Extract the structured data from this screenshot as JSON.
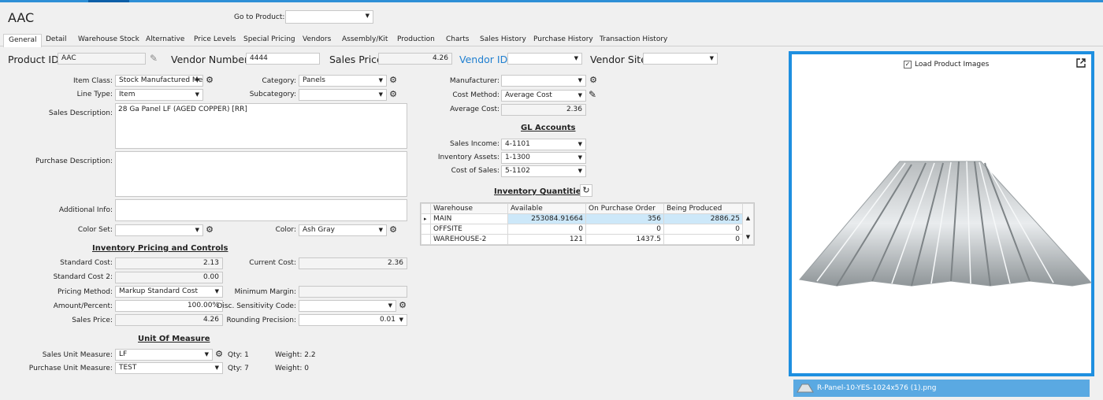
{
  "header": {
    "title": "AAC",
    "goto_label": "Go to Product:",
    "goto_value": ""
  },
  "tabs": [
    "General",
    "Detail",
    "Warehouse Stock",
    "Alternative",
    "Price Levels",
    "Special Pricing",
    "Vendors",
    "Assembly/Kit",
    "Production",
    "Charts",
    "Sales History",
    "Purchase History",
    "Transaction History"
  ],
  "top": {
    "product_id_label": "Product ID:",
    "product_id": "AAC",
    "vendor_number_label": "Vendor Number:",
    "vendor_number": "4444",
    "sales_price_label": "Sales Price:",
    "sales_price": "4.26",
    "vendor_id_label": "Vendor ID:",
    "vendor_id": "",
    "vendor_site_label": "Vendor Site:",
    "vendor_site": ""
  },
  "general": {
    "item_class_label": "Item Class:",
    "item_class": "Stock Manufactured Me",
    "line_type_label": "Line Type:",
    "line_type": "Item",
    "category_label": "Category:",
    "category": "Panels",
    "subcategory_label": "Subcategory:",
    "subcategory": "",
    "sales_description_label": "Sales Description:",
    "sales_description": "28 Ga Panel LF (AGED COPPER) [RR]",
    "purchase_description_label": "Purchase Description:",
    "purchase_description": "",
    "additional_info_label": "Additional Info:",
    "additional_info": "",
    "color_set_label": "Color Set:",
    "color_set": "",
    "color_label": "Color:",
    "color": "Ash Gray"
  },
  "pricing": {
    "title": "Inventory Pricing and Controls",
    "standard_cost_label": "Standard Cost:",
    "standard_cost": "2.13",
    "current_cost_label": "Current Cost:",
    "current_cost": "2.36",
    "standard_cost2_label": "Standard Cost 2:",
    "standard_cost2": "0.00",
    "pricing_method_label": "Pricing Method:",
    "pricing_method": "Markup Standard Cost",
    "minimum_margin_label": "Minimum Margin:",
    "minimum_margin": "",
    "amount_percent_label": "Amount/Percent:",
    "amount_percent": "100.00%",
    "disc_sensitivity_label": "Disc. Sensitivity Code:",
    "disc_sensitivity": "",
    "sales_price_label": "Sales Price:",
    "sales_price": "4.26",
    "rounding_label": "Rounding Precision:",
    "rounding": "0.01"
  },
  "uom": {
    "title": "Unit Of Measure",
    "sales_label": "Sales Unit Measure:",
    "sales": "LF",
    "sales_qty": "Qty: 1",
    "sales_weight": "Weight: 2.2",
    "purchase_label": "Purchase Unit Measure:",
    "purchase": "TEST",
    "purchase_qty": "Qty: 7",
    "purchase_weight": "Weight: 0"
  },
  "right": {
    "manufacturer_label": "Manufacturer:",
    "manufacturer": "",
    "cost_method_label": "Cost Method:",
    "cost_method": "Average Cost",
    "average_cost_label": "Average Cost:",
    "average_cost": "2.36",
    "gl_title": "GL Accounts",
    "sales_income_label": "Sales Income:",
    "sales_income": "4-1101",
    "inventory_assets_label": "Inventory Assets:",
    "inventory_assets": "1-1300",
    "cost_of_sales_label": "Cost of Sales:",
    "cost_of_sales": "5-1102",
    "inv_qty_title": "Inventory Quantities"
  },
  "inventory": {
    "columns": [
      "Warehouse",
      "Available",
      "On Purchase Order",
      "Being Produced"
    ],
    "rows": [
      [
        "MAIN",
        "253084.91664",
        "356",
        "2886.25"
      ],
      [
        "OFFSITE",
        "0",
        "0",
        "0"
      ],
      [
        "WAREHOUSE-2",
        "121",
        "1437.5",
        "0"
      ]
    ]
  },
  "image": {
    "load_label": "Load Product Images",
    "load_checked": true,
    "filename": "R-Panel-10-YES-1024x576 (1).png"
  },
  "colors": {
    "accent": "#1e8fe0",
    "link": "#1f7fd0",
    "selected_row": "#cde8f9"
  }
}
